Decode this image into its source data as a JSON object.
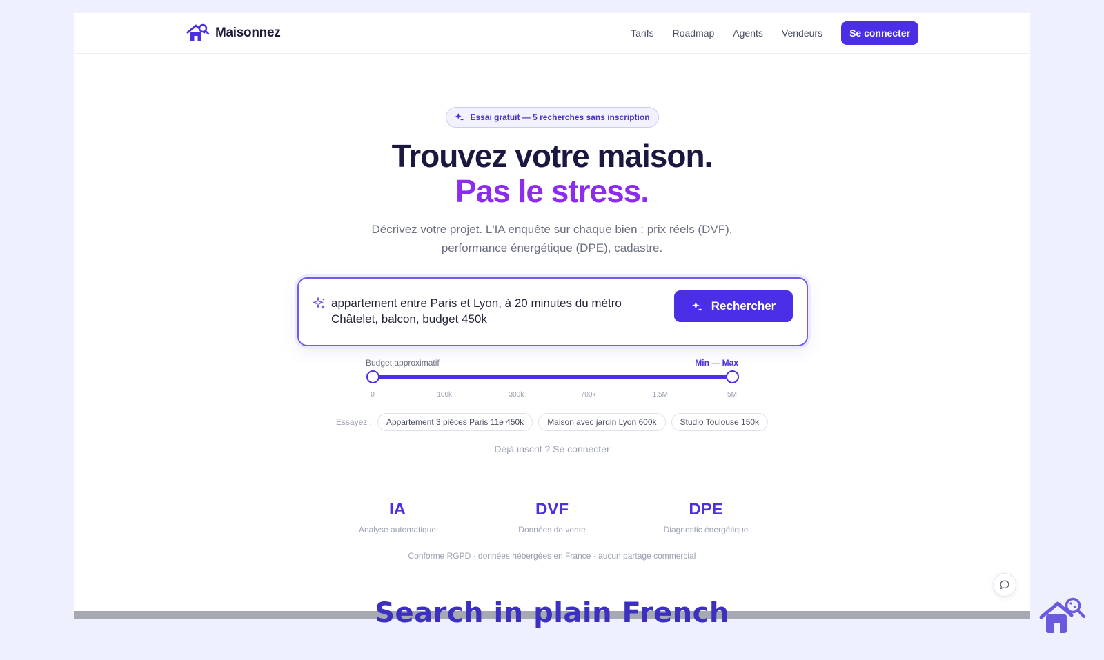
{
  "header": {
    "brand": "Maisonnez",
    "nav": [
      "Tarifs",
      "Roadmap",
      "Agents",
      "Vendeurs"
    ],
    "cta": "Se connecter"
  },
  "hero": {
    "badge": "Essai gratuit — 5 recherches sans inscription",
    "title_main": "Trouvez votre maison. ",
    "title_accent": "Pas le stress.",
    "subtitle": "Décrivez votre projet. L'IA enquête sur chaque bien : prix réels (DVF), performance énergétique (DPE), cadastre."
  },
  "search": {
    "query": "appartement entre Paris et Lyon, à 20 minutes du métro Châtelet, balcon, budget 450k",
    "button": "Rechercher"
  },
  "budget": {
    "label": "Budget approximatif",
    "min_label": "Min",
    "separator": "—",
    "max_label": "Max",
    "ticks": [
      "0",
      "100k",
      "300k",
      "700k",
      "1.5M",
      "5M"
    ],
    "min_fraction": 0,
    "max_fraction": 1
  },
  "suggestions": {
    "label": "Essayez :",
    "chips": [
      "Appartement 3 pièces Paris 11e 450k",
      "Maison avec jardin Lyon 600k",
      "Studio Toulouse 150k"
    ]
  },
  "login_link": "Déjà inscrit ? Se connecter",
  "stats": [
    {
      "value": "IA",
      "label": "Analyse automatique"
    },
    {
      "value": "DVF",
      "label": "Données de vente"
    },
    {
      "value": "DPE",
      "label": "Diagnostic énergétique"
    }
  ],
  "footnote": "Conforme RGPD · données hébergées en France · aucun partage commercial",
  "caption": "Search in plain French",
  "colors": {
    "accent": "#4b2fe6",
    "accent_purple": "#8b2cf0",
    "title": "#1a1740"
  }
}
